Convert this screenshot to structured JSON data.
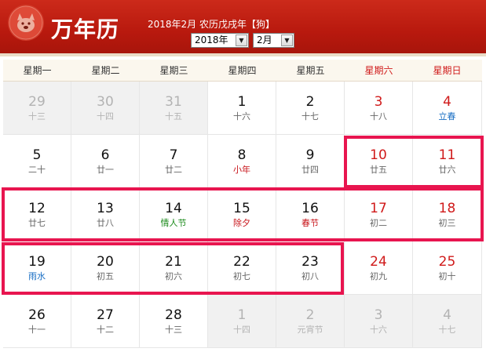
{
  "header": {
    "app_title": "万年历",
    "lunar_info": "2018年2月  农历戊戌年【狗】",
    "year_select": "2018年",
    "month_select": "2月",
    "colors": {
      "header_red": "#b8190e",
      "weekend_red": "#d01a1a",
      "highlight": "#e8154f"
    }
  },
  "weekdays": [
    "星期一",
    "星期二",
    "星期三",
    "星期四",
    "星期五",
    "星期六",
    "星期日"
  ],
  "weeks": [
    [
      {
        "day": "29",
        "lunar": "十三",
        "other": true
      },
      {
        "day": "30",
        "lunar": "十四",
        "other": true
      },
      {
        "day": "31",
        "lunar": "十五",
        "other": true
      },
      {
        "day": "1",
        "lunar": "十六"
      },
      {
        "day": "2",
        "lunar": "十七"
      },
      {
        "day": "3",
        "lunar": "十八"
      },
      {
        "day": "4",
        "lunar": "立春",
        "kind": "term"
      }
    ],
    [
      {
        "day": "5",
        "lunar": "二十"
      },
      {
        "day": "6",
        "lunar": "廿一"
      },
      {
        "day": "7",
        "lunar": "廿二"
      },
      {
        "day": "8",
        "lunar": "小年",
        "kind": "festival"
      },
      {
        "day": "9",
        "lunar": "廿四"
      },
      {
        "day": "10",
        "lunar": "廿五"
      },
      {
        "day": "11",
        "lunar": "廿六"
      }
    ],
    [
      {
        "day": "12",
        "lunar": "廿七"
      },
      {
        "day": "13",
        "lunar": "廿八"
      },
      {
        "day": "14",
        "lunar": "情人节",
        "kind": "green"
      },
      {
        "day": "15",
        "lunar": "除夕",
        "kind": "festival"
      },
      {
        "day": "16",
        "lunar": "春节",
        "kind": "festival"
      },
      {
        "day": "17",
        "lunar": "初二"
      },
      {
        "day": "18",
        "lunar": "初三"
      }
    ],
    [
      {
        "day": "19",
        "lunar": "雨水",
        "kind": "term"
      },
      {
        "day": "20",
        "lunar": "初五"
      },
      {
        "day": "21",
        "lunar": "初六"
      },
      {
        "day": "22",
        "lunar": "初七"
      },
      {
        "day": "23",
        "lunar": "初八"
      },
      {
        "day": "24",
        "lunar": "初九"
      },
      {
        "day": "25",
        "lunar": "初十"
      }
    ],
    [
      {
        "day": "26",
        "lunar": "十一"
      },
      {
        "day": "27",
        "lunar": "十二"
      },
      {
        "day": "28",
        "lunar": "十三"
      },
      {
        "day": "1",
        "lunar": "十四",
        "other": true
      },
      {
        "day": "2",
        "lunar": "元宵节",
        "other": true,
        "kind": "festival"
      },
      {
        "day": "3",
        "lunar": "十六",
        "other": true
      },
      {
        "day": "4",
        "lunar": "十七",
        "other": true
      }
    ]
  ]
}
